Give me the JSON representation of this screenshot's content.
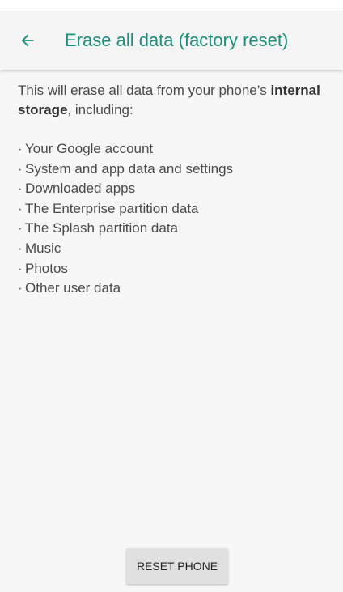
{
  "header": {
    "title": "Erase all data (factory reset)",
    "back_icon": "arrow-back-icon",
    "accent_color": "#1a8f7a"
  },
  "intro": {
    "prefix": "This will erase all data from your phone’s ",
    "bold": "internal storage",
    "suffix": ", including:"
  },
  "items": [
    "Your Google account",
    "System and app data and settings",
    "Downloaded apps",
    "The Enterprise partition data",
    "The Splash partition data",
    "Music",
    "Photos",
    "Other user data"
  ],
  "bullet": "·",
  "reset_button": {
    "label": "RESET PHONE"
  }
}
